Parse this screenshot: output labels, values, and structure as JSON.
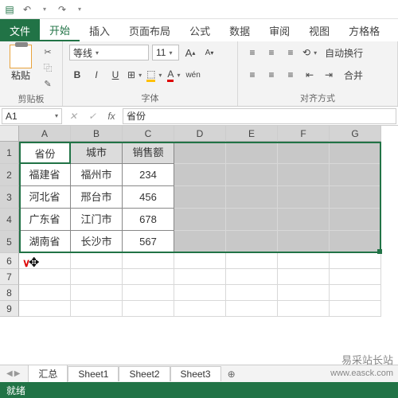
{
  "titlebar": {
    "save": "💾"
  },
  "tabs": {
    "file": "文件",
    "home": "开始",
    "insert": "插入",
    "pagelayout": "页面布局",
    "formulas": "公式",
    "data": "数据",
    "review": "审阅",
    "view": "视图",
    "squaregrid": "方格格"
  },
  "ribbon": {
    "clipboard": {
      "paste": "粘贴",
      "label": "剪贴板"
    },
    "font": {
      "name": "等线",
      "size": "11",
      "grow": "A",
      "shrink": "A",
      "label": "字体",
      "bold": "B",
      "italic": "I",
      "underline": "U"
    },
    "align": {
      "wrap": "自动换行",
      "merge": "合并",
      "label": "对齐方式"
    }
  },
  "formula_bar": {
    "cell_ref": "A1",
    "fx": "fx",
    "value": "省份"
  },
  "columns": [
    "A",
    "B",
    "C",
    "D",
    "E",
    "F",
    "G"
  ],
  "row_numbers": [
    "1",
    "2",
    "3",
    "4",
    "5",
    "6",
    "7",
    "8",
    "9"
  ],
  "chart_data": {
    "type": "table",
    "headers": [
      "省份",
      "城市",
      "销售额"
    ],
    "rows": [
      [
        "福建省",
        "福州市",
        234
      ],
      [
        "河北省",
        "邢台市",
        456
      ],
      [
        "广东省",
        "江门市",
        678
      ],
      [
        "湖南省",
        "长沙市",
        567
      ]
    ]
  },
  "sheets": {
    "active": "汇总",
    "tabs": [
      "汇总",
      "Sheet1",
      "Sheet2",
      "Sheet3"
    ]
  },
  "status": "就绪",
  "watermark": {
    "name": "易采站长站",
    "url": "www.easck.com"
  }
}
